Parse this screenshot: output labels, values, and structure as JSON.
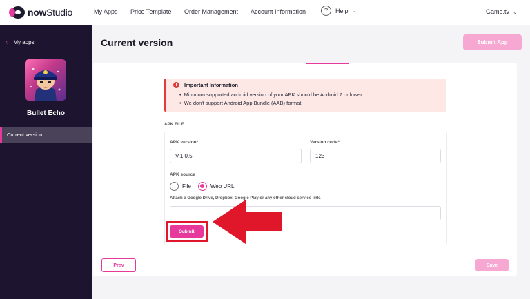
{
  "brand": {
    "name_bold": "now",
    "name_regular": "Studio",
    "accent": "#e6399b",
    "sidebar_bg": "#1d1430"
  },
  "nav": {
    "items": [
      {
        "label": "My Apps"
      },
      {
        "label": "Price Template"
      },
      {
        "label": "Order Management"
      },
      {
        "label": "Account Information"
      }
    ],
    "help": {
      "icon_glyph": "?",
      "label": "Help"
    },
    "account": {
      "label": "Game.tv"
    }
  },
  "sidebar": {
    "back_label": "My apps",
    "app_name": "Bullet Echo",
    "items": [
      {
        "label": "Current version"
      }
    ]
  },
  "header": {
    "title": "Current version",
    "submit_app_label": "Submit App"
  },
  "alert": {
    "title": "Important Information",
    "icon_glyph": "!",
    "lines": [
      "Minimum supported android version of your APK should be Android 7 or lower",
      "We don't support Android App Bundle (AAB) format"
    ]
  },
  "apk": {
    "section_label": "APK FILE",
    "version_label": "APK version*",
    "version_value": "V.1.0.5",
    "code_label": "Version code*",
    "code_value": "123",
    "source_label": "APK source",
    "options": [
      {
        "label": "File",
        "selected": false
      },
      {
        "label": "Web URL",
        "selected": true
      }
    ],
    "link_label": "Attach a Google Drive, Dropbox, Google Play or any other cloud service link.",
    "link_value": "",
    "submit_label": "Submit"
  },
  "footer": {
    "prev_label": "Prev",
    "save_label": "Save"
  },
  "annotation": {
    "highlight_color": "#e0162b"
  }
}
